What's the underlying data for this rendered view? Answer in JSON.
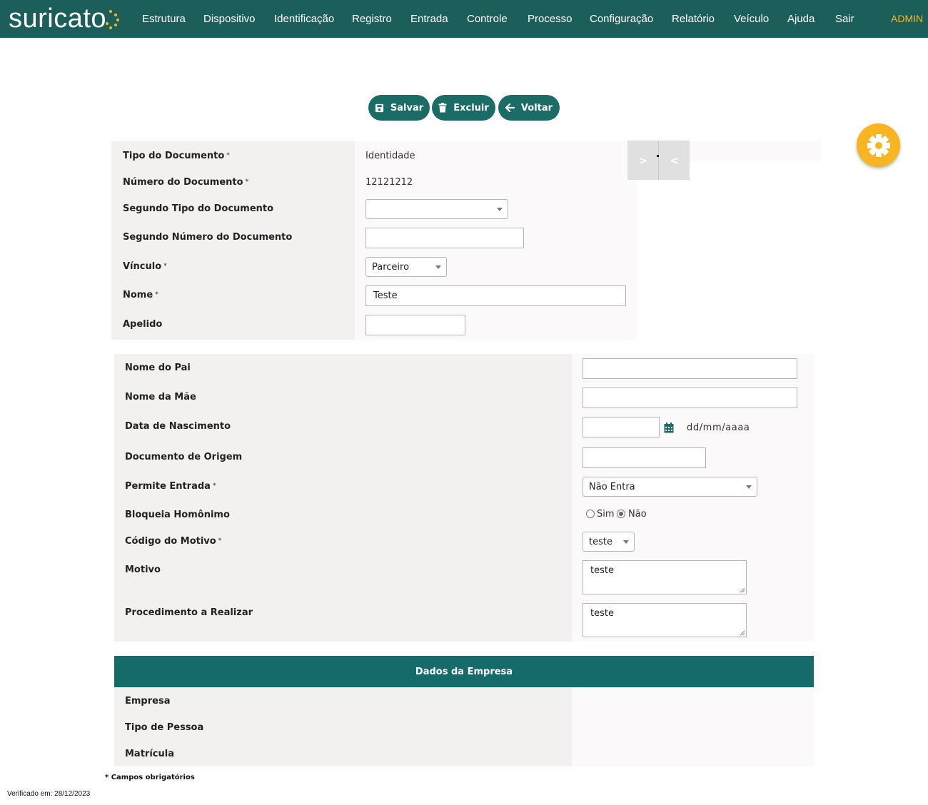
{
  "brand": {
    "name": "suricato",
    "accent": "#f5b821",
    "bar_color": "#1b5e5a"
  },
  "nav": {
    "items": [
      "Estrutura",
      "Dispositivo",
      "Identificação",
      "Registro",
      "Entrada",
      "Controle",
      "Processo",
      "Configuração",
      "Relatório",
      "Veículo",
      "Ajuda",
      "Sair"
    ],
    "user": "ADMIN"
  },
  "actions": {
    "save": "Salvar",
    "delete": "Excluir",
    "back": "Voltar"
  },
  "toggle": {
    "expand": ">",
    "collapse": "<"
  },
  "document": {
    "tipo_label": "Tipo do Documento",
    "tipo_value": "Identidade",
    "numero_label": "Número do Documento",
    "numero_value": "12121212",
    "segundo_tipo_label": "Segundo Tipo do Documento",
    "segundo_tipo_value": "",
    "segundo_numero_label": "Segundo Número do Documento",
    "segundo_numero_value": "",
    "vinculo_label": "Vínculo",
    "vinculo_value": "Parceiro",
    "nome_label": "Nome",
    "nome_value": "Teste",
    "apelido_label": "Apelido",
    "apelido_value": ""
  },
  "person": {
    "pai_label": "Nome do Pai",
    "pai_value": "",
    "mae_label": "Nome da Mãe",
    "mae_value": "",
    "nascimento_label": "Data de Nascimento",
    "nascimento_value": "",
    "nascimento_format": "dd/mm/aaaa",
    "origem_label": "Documento de Origem",
    "origem_value": "",
    "permite_label": "Permite Entrada",
    "permite_value": "Não Entra",
    "bloqueia_label": "Bloqueia Homônimo",
    "bloqueia_sim": "Sim",
    "bloqueia_nao": "Não",
    "bloqueia_selected": "Não",
    "codigo_label": "Código do Motivo",
    "codigo_value": "teste",
    "motivo_label": "Motivo",
    "motivo_value": "teste",
    "procedimento_label": "Procedimento a Realizar",
    "procedimento_value": "teste"
  },
  "company": {
    "header": "Dados da Empresa",
    "empresa_label": "Empresa",
    "tipo_pessoa_label": "Tipo de Pessoa",
    "matricula_label": "Matrícula"
  },
  "required_mark": "*",
  "footer": {
    "required_note": "* Campos obrigatórios",
    "verified": "Verificado em: 28/12/2023"
  }
}
